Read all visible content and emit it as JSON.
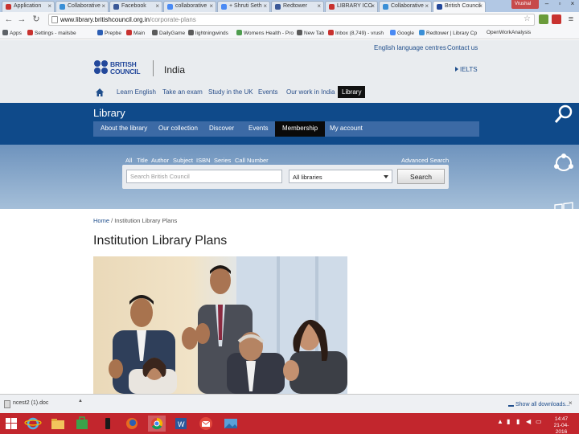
{
  "browser": {
    "tabs": [
      {
        "label": "Application",
        "color": "#c8322f"
      },
      {
        "label": "Collaborative",
        "color": "#3a8fd6"
      },
      {
        "label": "Facebook",
        "color": "#3b5998"
      },
      {
        "label": "collaborative",
        "color": "#4a8af4"
      },
      {
        "label": "+ Shruti Seth",
        "color": "#4a8af4"
      },
      {
        "label": "Redtower",
        "color": "#3b5998"
      },
      {
        "label": "LIBRARY ICO",
        "color": "#c8322f"
      },
      {
        "label": "Collaborative",
        "color": "#3a8fd6"
      },
      {
        "label": "British Council",
        "color": "#23489b"
      }
    ],
    "profile_name": "Vrushal",
    "url_host": "www.library.britishcouncil.org.in",
    "url_path": "/corporate-plans",
    "bookmarks": [
      {
        "label": "Apps",
        "color": "#5f6368"
      },
      {
        "label": "Settings - mailsbe",
        "color": "#c8322f"
      },
      {
        "label": "Prepbe",
        "color": "#2d5fb4"
      },
      {
        "label": "Main",
        "color": "#c8322f"
      },
      {
        "label": "DailyGame",
        "color": "#5b5b5b"
      },
      {
        "label": "lightningwinds",
        "color": "#5b5b5b"
      },
      {
        "label": "Womens Health - Pro",
        "color": "#4f9d4f"
      },
      {
        "label": "New Tab",
        "color": "#5b5b5b"
      },
      {
        "label": "Inbox (8,749) - vrush",
        "color": "#c8322f"
      },
      {
        "label": "Google",
        "color": "#4a8af4"
      },
      {
        "label": "Redtower | Library Cp",
        "color": "#3a8fd6"
      },
      {
        "label": "OpenWorkAnalysis",
        "color": "#5b5b5b"
      }
    ]
  },
  "site": {
    "util_links": [
      "English language centres",
      "Contact us"
    ],
    "logo_line1": "BRITISH",
    "logo_line2": "COUNCIL",
    "country": "India",
    "ielts": "IELTS",
    "main_nav": [
      "Learn English",
      "Take an exam",
      "Study in the UK",
      "Events",
      "Our work in India",
      "Library"
    ],
    "section_title": "Library",
    "sub_nav": [
      "About the library",
      "Our collection",
      "Discover",
      "Events",
      "Membership",
      "My account"
    ],
    "search": {
      "filters": [
        "All",
        "Title",
        "Author",
        "Subject",
        "ISBN",
        "Series",
        "Call Number"
      ],
      "advanced": "Advanced Search",
      "placeholder": "Search British Council",
      "library": "All libraries",
      "button": "Search"
    },
    "breadcrumb": {
      "home": "Home",
      "separator": " / ",
      "current": "Institution Library Plans"
    },
    "page_title": "Institution Library Plans"
  },
  "downloads": {
    "file": "ncest2 (1).doc",
    "show_all": "Show all downloads..."
  },
  "taskbar": {
    "time": "14:47",
    "date": "21-04-2016"
  },
  "colors": {
    "brand_blue": "#23489b",
    "band_blue": "#0f4a8a",
    "taskbar_red": "#c2262d"
  }
}
